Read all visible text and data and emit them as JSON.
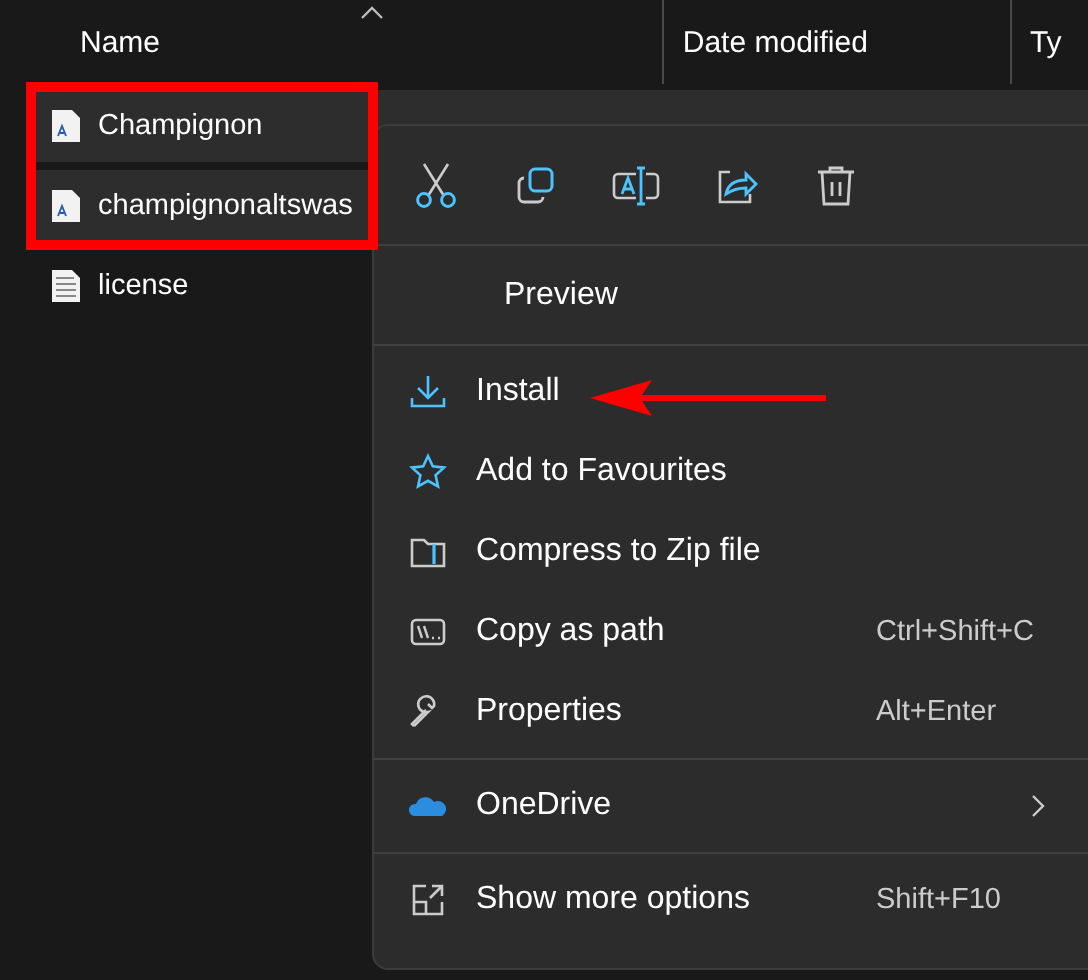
{
  "columns": [
    {
      "label": "Name",
      "sorted": true
    },
    {
      "label": "Date modified"
    },
    {
      "label": "Ty"
    }
  ],
  "files": [
    {
      "kind": "font",
      "name": "Champignon",
      "selected": true
    },
    {
      "kind": "font",
      "name": "champignonaltswas",
      "selected": true
    },
    {
      "kind": "text",
      "name": "license",
      "selected": false
    }
  ],
  "context_menu": {
    "sections": [
      [
        {
          "label": "Preview"
        }
      ],
      [
        {
          "label": "Install"
        },
        {
          "label": "Add to Favourites"
        },
        {
          "label": "Compress to Zip file"
        },
        {
          "label": "Copy as path",
          "shortcut": "Ctrl+Shift+C"
        },
        {
          "label": "Properties",
          "shortcut": "Alt+Enter"
        }
      ],
      [
        {
          "label": "OneDrive",
          "submenu": true
        }
      ],
      [
        {
          "label": "Show more options",
          "shortcut": "Shift+F10"
        }
      ]
    ]
  }
}
